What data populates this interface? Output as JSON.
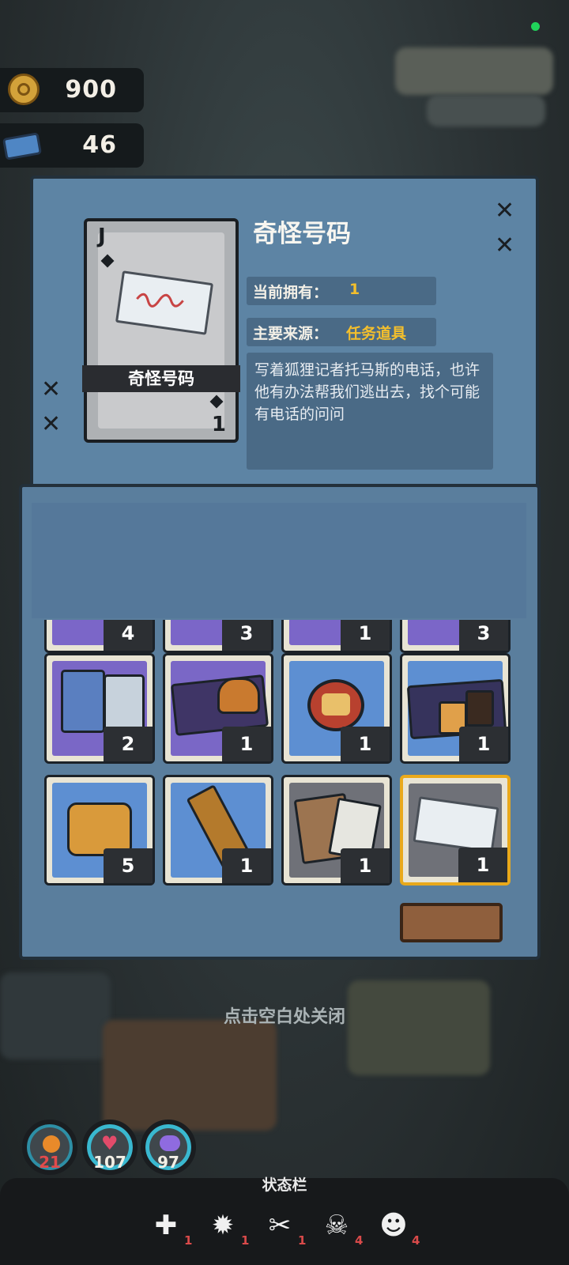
{
  "resources": {
    "coins": "900",
    "tickets": "46"
  },
  "item": {
    "title": "奇怪号码",
    "card_rank": "J",
    "card_number": "1",
    "card_label": "奇怪号码",
    "owned_label": "当前拥有：",
    "owned_value": "1",
    "source_label": "主要来源：",
    "source_value": "任务道具",
    "description": "写着狐狸记者托马斯的电话，也许他有办法帮我们逃出去，找个可能有电话的问问"
  },
  "inventory": {
    "top_row_counts": [
      "4",
      "3",
      "1",
      "3"
    ],
    "rows": [
      [
        {
          "icon": "pill-pack-icon",
          "count": "2"
        },
        {
          "icon": "burger-meal-icon",
          "count": "1"
        },
        {
          "icon": "cat-cookie-icon",
          "count": "1"
        },
        {
          "icon": "breakfast-pack-icon",
          "count": "1"
        }
      ],
      [
        {
          "icon": "sandwich-icon",
          "count": "5"
        },
        {
          "icon": "snack-bar-icon",
          "count": "1"
        },
        {
          "icon": "documents-icon",
          "count": "1"
        },
        {
          "icon": "strange-number-note-icon",
          "count": "1"
        }
      ]
    ]
  },
  "hint": "点击空白处关闭",
  "stats": [
    {
      "icon": "hunger-icon",
      "value": "21",
      "color": "#e88a2a"
    },
    {
      "icon": "heart-icon",
      "value": "107",
      "color": "#e24b6a"
    },
    {
      "icon": "brain-icon",
      "value": "97",
      "color": "#8f6be0"
    }
  ],
  "status_bar": {
    "title": "状态栏",
    "items": [
      {
        "icon": "bandage-icon",
        "count": "1"
      },
      {
        "icon": "virus-icon",
        "count": "1"
      },
      {
        "icon": "crossed-utensils-icon",
        "count": "1"
      },
      {
        "icon": "skull-icon",
        "count": "4"
      },
      {
        "icon": "masks-icon",
        "count": "4"
      }
    ]
  }
}
